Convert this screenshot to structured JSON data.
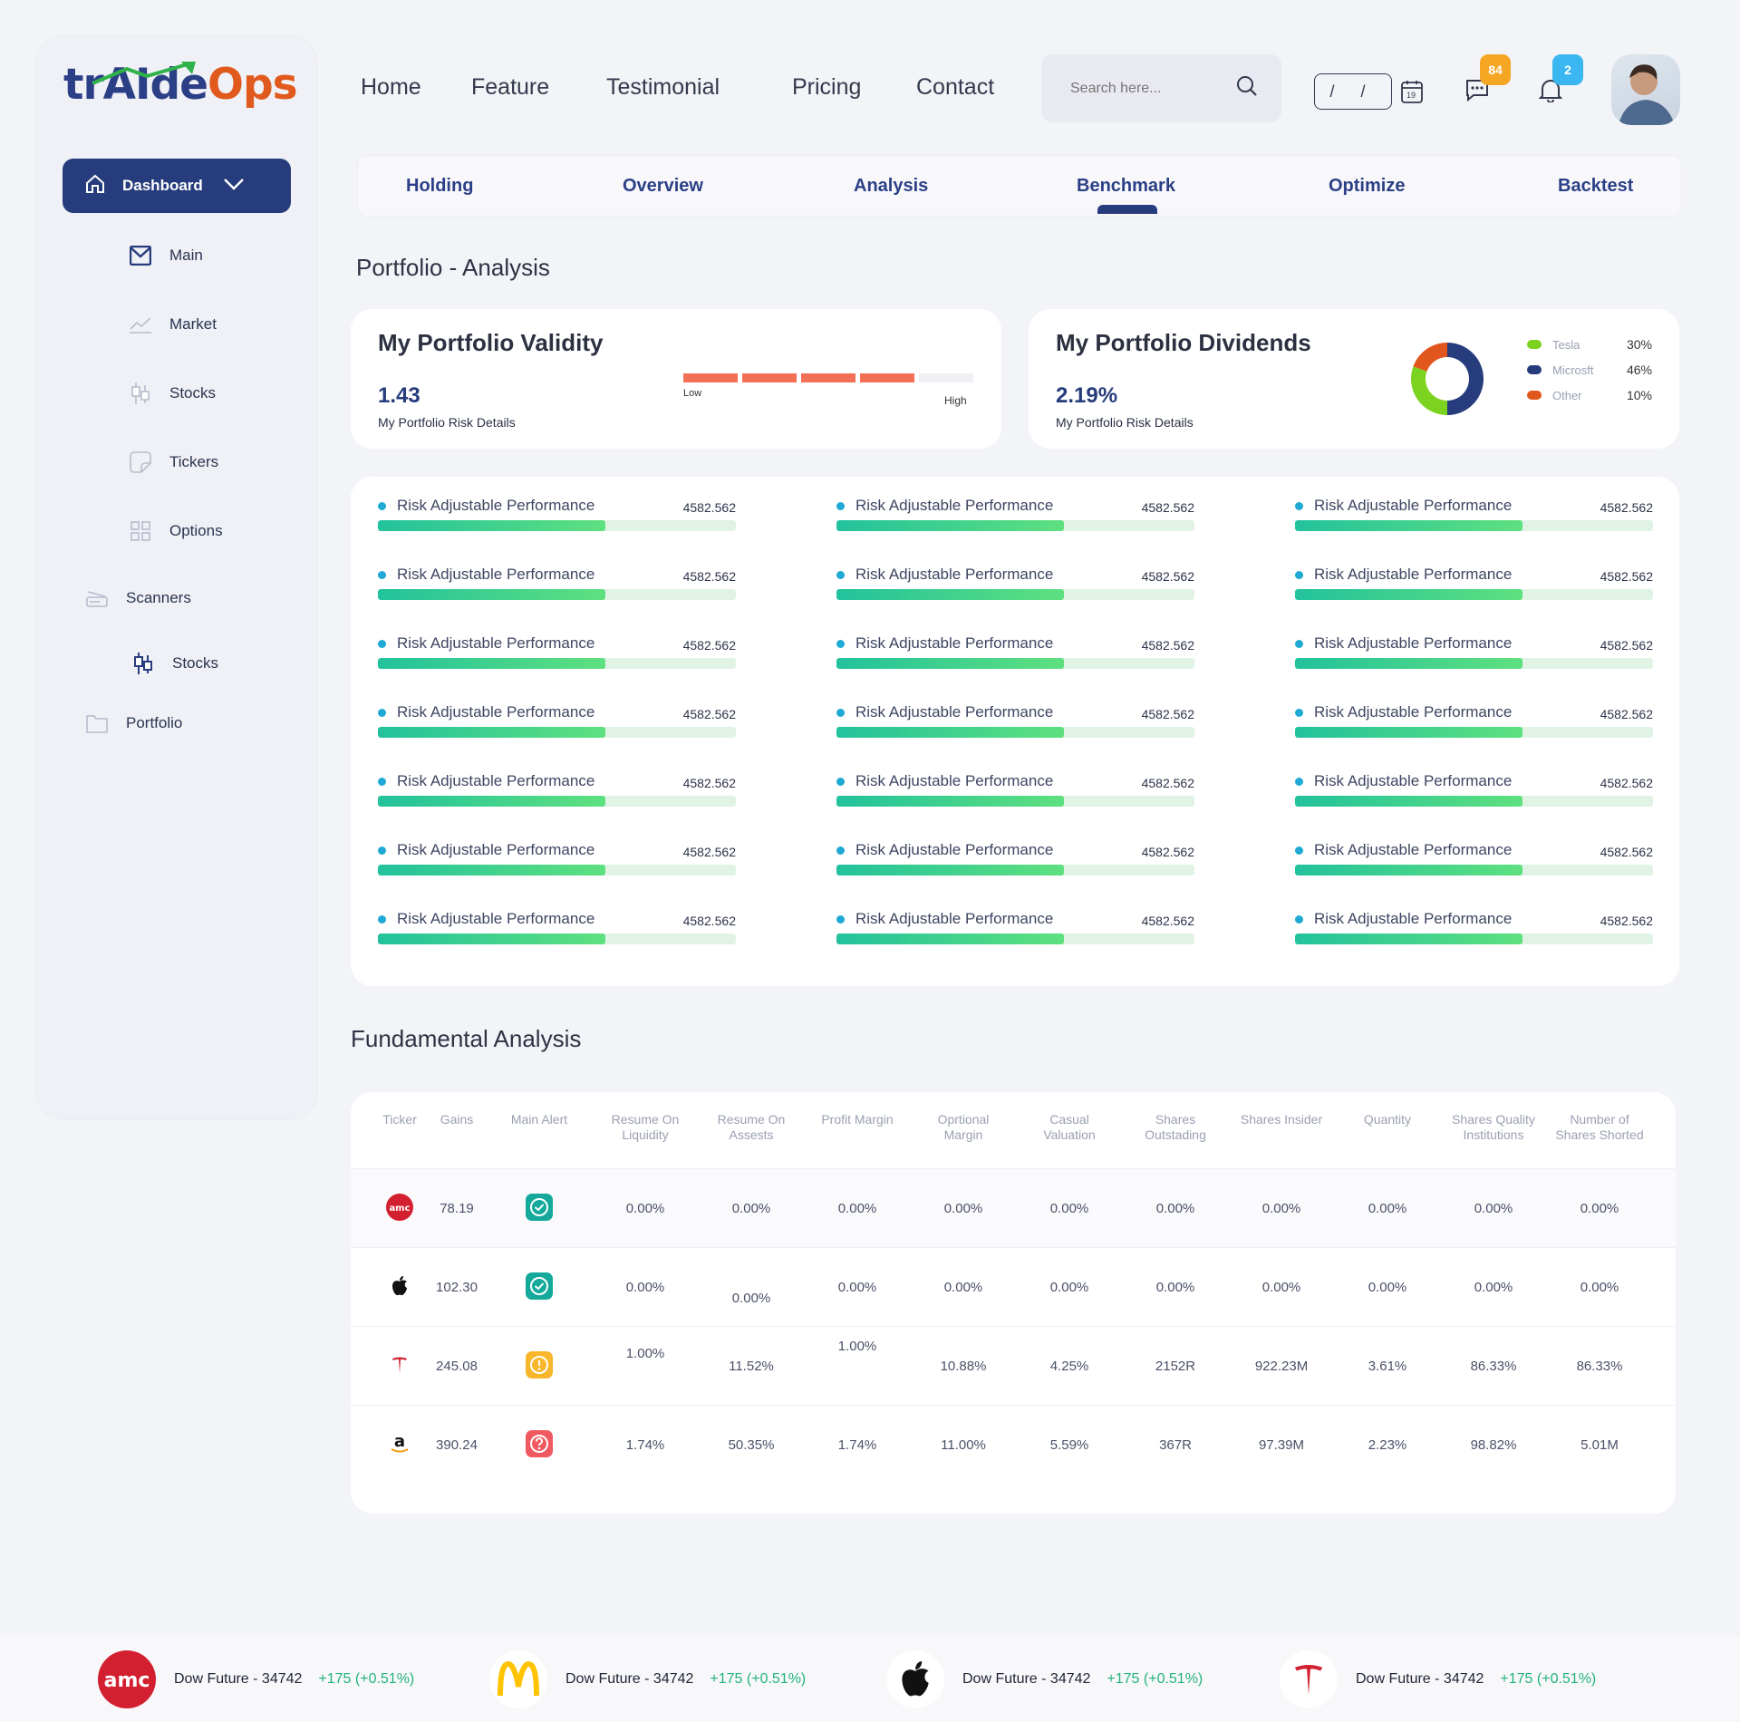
{
  "brand": {
    "logo_part1": "trAIde",
    "logo_part2": "Ops"
  },
  "sidebar": {
    "dashboard": "Dashboard",
    "items": [
      {
        "label": "Main",
        "icon": "mail-icon"
      },
      {
        "label": "Market",
        "icon": "chart-line-icon"
      },
      {
        "label": "Stocks",
        "icon": "candlestick-icon"
      },
      {
        "label": "Tickers",
        "icon": "sticker-icon"
      },
      {
        "label": "Options",
        "icon": "grid-icon"
      },
      {
        "label": "Scanners",
        "icon": "scanner-icon"
      },
      {
        "label": "Stocks",
        "icon": "candlestick-icon"
      },
      {
        "label": "Portfolio",
        "icon": "folder-icon"
      }
    ]
  },
  "nav": {
    "home": "Home",
    "feature": "Feature",
    "testimonial": "Testimonial",
    "pricing": "Pricing",
    "contact": "Contact"
  },
  "search": {
    "placeholder": "Search here..."
  },
  "date": {
    "value": "/ /",
    "calendar_day": "19"
  },
  "badges": {
    "messages": "84",
    "notifications": "2"
  },
  "tabs": [
    "Holding",
    "Overview",
    "Analysis",
    "Benchmark",
    "Optimize",
    "Backtest"
  ],
  "active_tab": "Benchmark",
  "page_title": "Portfolio - Analysis",
  "validity": {
    "title": "My Portfolio Validity",
    "value": "1.43",
    "subtitle": "My Portfolio Risk Details",
    "low": "Low",
    "high": "High",
    "filled_segments": 4,
    "total_segments": 5,
    "color": "#f36f56"
  },
  "dividends": {
    "title": "My Portfolio Dividends",
    "value": "2.19%",
    "subtitle": "My Portfolio Risk Details",
    "legend": [
      {
        "name": "Tesla",
        "pct": "30%",
        "color": "#7bd31f"
      },
      {
        "name": "Microsft",
        "pct": "46%",
        "color": "#263c7c"
      },
      {
        "name": "Other",
        "pct": "10%",
        "color": "#e0561c"
      }
    ]
  },
  "performance": {
    "label": "Risk Adjustable Performance",
    "value": "4582.562",
    "fill_fraction": 0.635,
    "rows": 7,
    "cols": 3
  },
  "fundamental": {
    "title": "Fundamental Analysis",
    "headers": [
      "Ticker",
      "Gains",
      "Main Alert",
      "Resume On Liquidity",
      "Resume On Assests",
      "Profit Margin",
      "Oprtional Margin",
      "Casual Valuation",
      "Shares Outstading",
      "Shares Insider",
      "Quantity",
      "Shares Quality Institutions",
      "Number of Shares Shorted"
    ],
    "rows": [
      {
        "ticker": "amc-logo",
        "gains": "78.19",
        "alert": "check",
        "cells": [
          "0.00%",
          "0.00%",
          "0.00%",
          "0.00%",
          "0.00%",
          "0.00%",
          "0.00%",
          "0.00%",
          "0.00%",
          "0.00%"
        ]
      },
      {
        "ticker": "apple-logo",
        "gains": "102.30",
        "alert": "check",
        "cells": [
          "0.00%",
          "0.00%",
          "0.00%",
          "0.00%",
          "0.00%",
          "0.00%",
          "0.00%",
          "0.00%",
          "0.00%",
          "0.00%"
        ]
      },
      {
        "ticker": "tesla-logo",
        "gains": "245.08",
        "alert": "warning",
        "cells": [
          "1.00%",
          "11.52%",
          "1.00%",
          "10.88%",
          "4.25%",
          "2152R",
          "922.23M",
          "3.61%",
          "86.33%",
          "86.33%"
        ]
      },
      {
        "ticker": "amazon-logo",
        "gains": "390.24",
        "alert": "question",
        "cells": [
          "1.74%",
          "50.35%",
          "1.74%",
          "11.00%",
          "5.59%",
          "367R",
          "97.39M",
          "2.23%",
          "98.82%",
          "5.01M"
        ]
      }
    ]
  },
  "ticker_bar": [
    {
      "logo": "amc-logo",
      "name": "Dow Future - 34742",
      "change": "+175 (+0.51%)"
    },
    {
      "logo": "mcdonalds-logo",
      "name": "Dow Future - 34742",
      "change": "+175 (+0.51%)"
    },
    {
      "logo": "apple-logo",
      "name": "Dow Future - 34742",
      "change": "+175 (+0.51%)"
    },
    {
      "logo": "tesla-logo",
      "name": "Dow Future - 34742",
      "change": "+175 (+0.51%)"
    }
  ],
  "colors": {
    "primary": "#263c7c",
    "accent_orange": "#e05a1e",
    "bar_green": "#5ee07f",
    "positive": "#23b27e",
    "badge_orange": "#f5a623",
    "badge_blue": "#3ab7f0"
  }
}
